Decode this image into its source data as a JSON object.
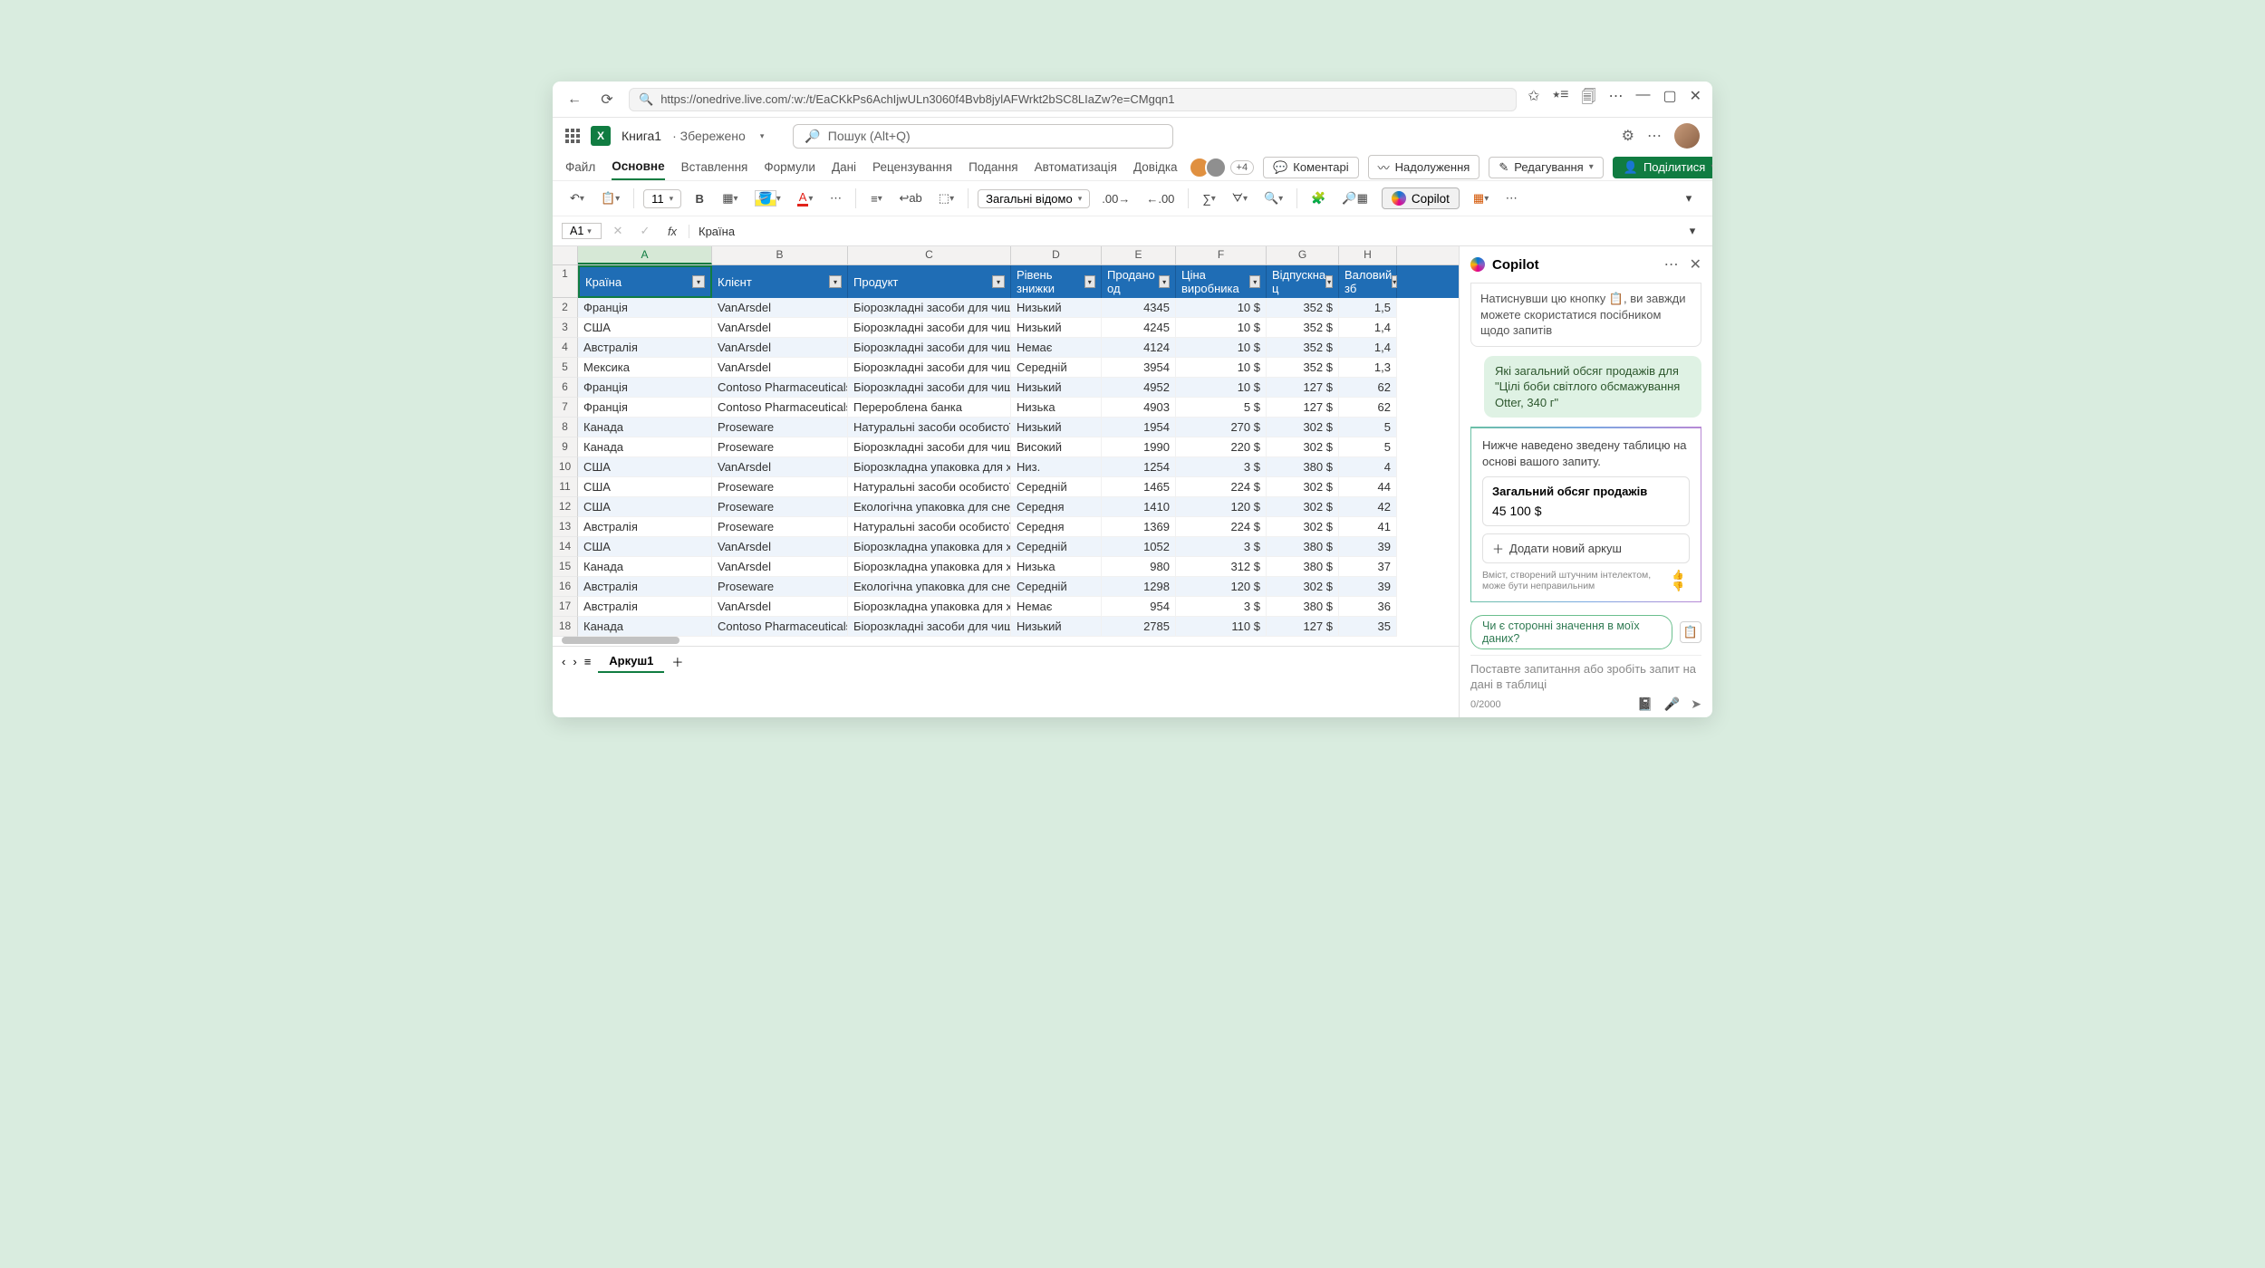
{
  "browser": {
    "url": "https://onedrive.live.com/:w:/t/EaCKkPs6AchIjwULn3060f4Bvb8jylAFWrkt2bSC8LIaZw?e=CMgqn1"
  },
  "app": {
    "document_name": "Книга1",
    "save_status": "Збережено",
    "search_placeholder": "Пошук (Alt+Q)"
  },
  "ribbon": {
    "tabs": [
      "Файл",
      "Основне",
      "Вставлення",
      "Формули",
      "Дані",
      "Рецензування",
      "Подання",
      "Автоматизація",
      "Довідка"
    ],
    "presence_extra": "+4",
    "comments_label": "Коментарі",
    "catchup_label": "Надолуження",
    "editing_label": "Редагування",
    "share_label": "Поділитися"
  },
  "toolbar": {
    "font_size": "11",
    "number_format": "Загальні відомо",
    "copilot_label": "Copilot"
  },
  "formula_bar": {
    "name_box": "A1",
    "formula": "Країна"
  },
  "grid": {
    "col_letters": [
      "A",
      "B",
      "C",
      "D",
      "E",
      "F",
      "G",
      "H"
    ],
    "headers": [
      "Країна",
      "Клієнт",
      "Продукт",
      "Рівень знижки",
      "Продано од",
      "Ціна виробника",
      "Відпускна ц",
      "Валовий зб"
    ],
    "rows": [
      {
        "n": "2",
        "c": [
          "Франція",
          "VanArsdel",
          "Біорозкладні засоби для чищенн",
          "Низький",
          "4345",
          "10 $",
          "352 $",
          "1,5"
        ]
      },
      {
        "n": "3",
        "c": [
          "США",
          "VanArsdel",
          "Біорозкладні засоби для чищенн",
          "Низький",
          "4245",
          "10 $",
          "352 $",
          "1,4"
        ]
      },
      {
        "n": "4",
        "c": [
          "Австралія",
          "VanArsdel",
          "Біорозкладні засоби для чищенн",
          "Немає",
          "4124",
          "10 $",
          "352 $",
          "1,4"
        ]
      },
      {
        "n": "5",
        "c": [
          "Мексика",
          "VanArsdel",
          "Біорозкладні засоби для чищенн",
          "Середній",
          "3954",
          "10 $",
          "352 $",
          "1,3"
        ]
      },
      {
        "n": "6",
        "c": [
          "Франція",
          "Contoso Pharmaceuticals",
          "Біорозкладні засоби для чищенн",
          "Низький",
          "4952",
          "10 $",
          "127 $",
          "62"
        ]
      },
      {
        "n": "7",
        "c": [
          "Франція",
          "Contoso Pharmaceuticals",
          "Перероблена банка",
          "Низька",
          "4903",
          "5 $",
          "127 $",
          "62"
        ]
      },
      {
        "n": "8",
        "c": [
          "Канада",
          "Proseware",
          "Натуральні засоби особистої гігіє",
          "Низький",
          "1954",
          "270 $",
          "302 $",
          "5"
        ]
      },
      {
        "n": "9",
        "c": [
          "Канада",
          "Proseware",
          "Біорозкладні засоби для чищенн",
          "Високий",
          "1990",
          "220 $",
          "302 $",
          "5"
        ]
      },
      {
        "n": "10",
        "c": [
          "США",
          "VanArsdel",
          "Біорозкладна упаковка для харч",
          "Низ.",
          "1254",
          "3 $",
          "380 $",
          "4"
        ]
      },
      {
        "n": "11",
        "c": [
          "США",
          "Proseware",
          "Натуральні засоби особистої гігіє",
          "Середній",
          "1465",
          "224 $",
          "302 $",
          "44"
        ]
      },
      {
        "n": "12",
        "c": [
          "США",
          "Proseware",
          "Екологічна упаковка для снеків",
          "Середня",
          "1410",
          "120 $",
          "302 $",
          "42"
        ]
      },
      {
        "n": "13",
        "c": [
          "Австралія",
          "Proseware",
          "Натуральні засоби особистої гігіє",
          "Середня",
          "1369",
          "224 $",
          "302 $",
          "41"
        ]
      },
      {
        "n": "14",
        "c": [
          "США",
          "VanArsdel",
          "Біорозкладна упаковка для харч",
          "Середній",
          "1052",
          "3 $",
          "380 $",
          "39"
        ]
      },
      {
        "n": "15",
        "c": [
          "Канада",
          "VanArsdel",
          "Біорозкладна упаковка для харч",
          "Низька",
          "980",
          "312 $",
          "380 $",
          "37"
        ]
      },
      {
        "n": "16",
        "c": [
          "Австралія",
          "Proseware",
          "Екологічна упаковка для снеків",
          "Середній",
          "1298",
          "120 $",
          "302 $",
          "39"
        ]
      },
      {
        "n": "17",
        "c": [
          "Австралія",
          "VanArsdel",
          "Біорозкладна упаковка для харч",
          "Немає",
          "954",
          "3 $",
          "380 $",
          "36"
        ]
      },
      {
        "n": "18",
        "c": [
          "Канада",
          "Contoso Pharmaceuticals",
          "Біорозкладні засоби для чищенн",
          "Низький",
          "2785",
          "110 $",
          "127 $",
          "35"
        ]
      }
    ]
  },
  "sheet": {
    "name": "Аркуш1"
  },
  "copilot": {
    "title": "Copilot",
    "info_text": "Натиснувши цю кнопку 📋, ви завжди можете скористатися посібником щодо запитів",
    "user_prompt": "Які загальний обсяг продажів для \"Цілі боби світлого обсмажування Otter, 340 г\"",
    "answer_intro": "Нижче наведено зведену таблицю на основі вашого запиту.",
    "result_title": "Загальний обсяг продажів",
    "result_value": "45 100 $",
    "add_sheet_label": "Додати новий аркуш",
    "disclaimer": "Вміст, створений штучним інтелектом, може бути неправильним",
    "suggestion": "Чи є сторонні значення в моїх даних?",
    "input_placeholder": "Поставте запитання або зробіть запит на дані в таблиці",
    "counter": "0/2000"
  }
}
